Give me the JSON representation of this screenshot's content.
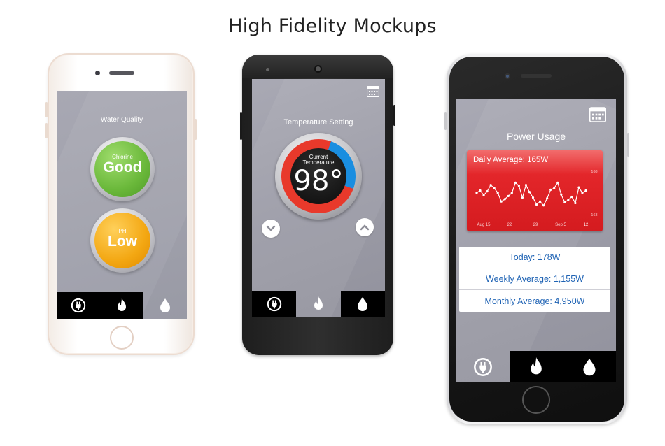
{
  "page": {
    "title": "High Fidelity Mockups"
  },
  "water_screen": {
    "title": "Water Quality",
    "chlorine": {
      "label": "Chlorine",
      "value": "Good",
      "color": "#6ab83a"
    },
    "ph": {
      "label": "PH",
      "value": "Low",
      "color": "#f3a712"
    },
    "tabs": [
      {
        "icon": "plug-icon",
        "active": false
      },
      {
        "icon": "flame-icon",
        "active": false
      },
      {
        "icon": "water-drop-icon",
        "active": true
      }
    ]
  },
  "temperature_screen": {
    "title": "Temperature Setting",
    "dial_label_line1": "Current",
    "dial_label_line2": "Temperature",
    "temperature": "98°",
    "ring_colors": {
      "hot": "#e8392b",
      "cool": "#1a8ee0"
    },
    "tabs": [
      {
        "icon": "plug-icon",
        "active": false
      },
      {
        "icon": "flame-icon",
        "active": true
      },
      {
        "icon": "water-drop-icon",
        "active": false
      }
    ]
  },
  "power_screen": {
    "title": "Power Usage",
    "stats": [
      {
        "text": "Today: 178W"
      },
      {
        "text": "Weekly Average: 1,155W"
      },
      {
        "text": "Monthly Average: 4,950W"
      }
    ],
    "tabs": [
      {
        "icon": "plug-icon",
        "active": true
      },
      {
        "icon": "flame-icon",
        "active": false
      },
      {
        "icon": "water-drop-icon",
        "active": false
      }
    ]
  },
  "chart_data": {
    "type": "line",
    "title": "Daily Average: 165W",
    "x_ticks": [
      "Aug 15",
      "22",
      "29",
      "Sep 5",
      "12"
    ],
    "y_ticks": [
      "168",
      "163"
    ],
    "ylim": [
      163,
      168
    ],
    "grid": false,
    "series": [
      {
        "values": [
          165.6,
          165.9,
          165.3,
          165.8,
          166.6,
          166.2,
          165.6,
          164.5,
          164.8,
          165.2,
          165.6,
          166.9,
          166.5,
          165.0,
          166.6,
          165.7,
          165.0,
          164.1,
          164.5,
          164.0,
          164.9,
          166.0,
          166.2,
          166.9,
          165.4,
          164.4,
          164.7,
          165.1,
          164.3,
          166.3,
          165.6,
          165.9
        ]
      }
    ]
  }
}
